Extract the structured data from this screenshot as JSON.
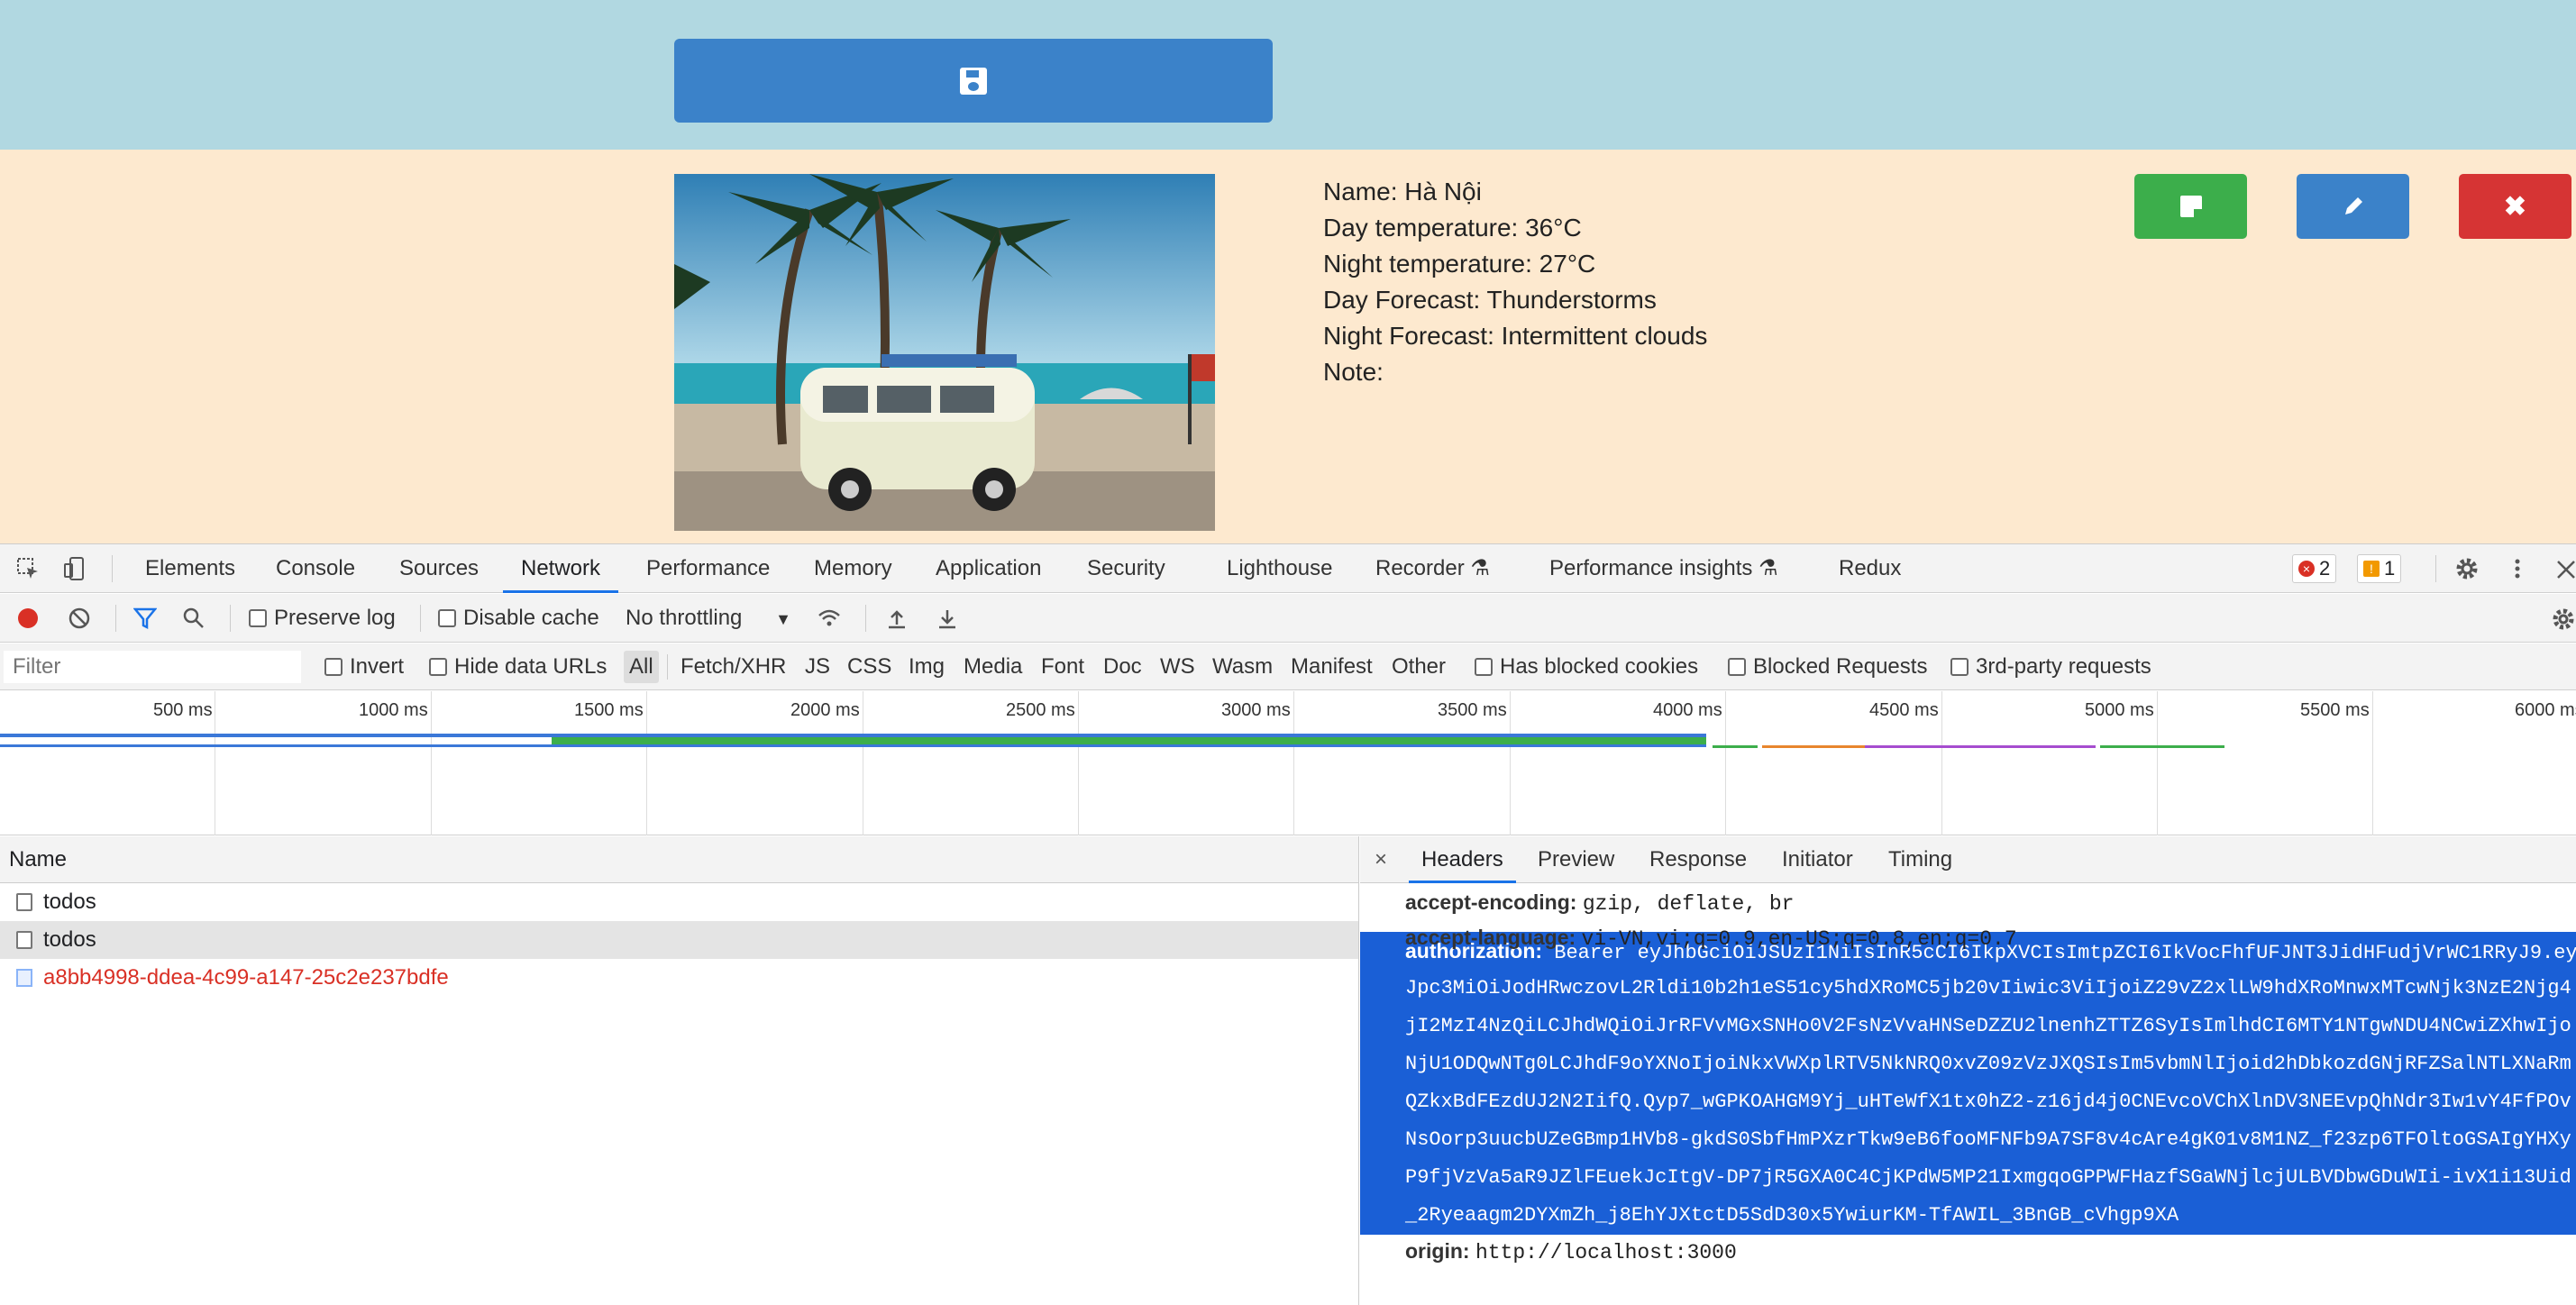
{
  "app": {
    "details": {
      "name": "Name: Hà Nội",
      "day_temp": "Day temperature: 36°C",
      "night_temp": "Night temperature: 27°C",
      "day_forecast": "Day Forecast: Thunderstorms",
      "night_forecast": "Night Forecast: Intermittent clouds",
      "note": "Note:"
    },
    "delete_label": "✖"
  },
  "devtools": {
    "tabs": [
      "Elements",
      "Console",
      "Sources",
      "Network",
      "Performance",
      "Memory",
      "Application",
      "Security",
      "Lighthouse",
      "Recorder",
      "Performance insights",
      "Redux"
    ],
    "active_tab": "Network",
    "errors": "2",
    "warnings": "1",
    "toolbar": {
      "preserve_log": "Preserve log",
      "disable_cache": "Disable cache",
      "throttling": "No throttling"
    },
    "filter": {
      "placeholder": "Filter",
      "invert": "Invert",
      "hide_data_urls": "Hide data URLs",
      "types": [
        "All",
        "Fetch/XHR",
        "JS",
        "CSS",
        "Img",
        "Media",
        "Font",
        "Doc",
        "WS",
        "Wasm",
        "Manifest",
        "Other"
      ],
      "has_blocked_cookies": "Has blocked cookies",
      "blocked_requests": "Blocked Requests",
      "third_party": "3rd-party requests"
    },
    "timeline_ticks": [
      "500 ms",
      "1000 ms",
      "1500 ms",
      "2000 ms",
      "2500 ms",
      "3000 ms",
      "3500 ms",
      "4000 ms",
      "4500 ms",
      "5000 ms",
      "5500 ms",
      "6000 ms"
    ],
    "requests": {
      "header": "Name",
      "rows": [
        "todos",
        "todos",
        "a8bb4998-ddea-4c99-a147-25c2e237bdfe"
      ]
    },
    "details": {
      "close": "×",
      "tabs": [
        "Headers",
        "Preview",
        "Response",
        "Initiator",
        "Timing"
      ],
      "accept_encoding_key": "accept-encoding:",
      "accept_encoding_val": "gzip, deflate, br",
      "accept_language_key": "accept-language:",
      "accept_language_val": "vi-VN,vi;q=0.9,en-US;q=0.8,en;q=0.7",
      "authorization_key": "authorization:",
      "authorization_lines": [
        "Bearer eyJhbGciOiJSUzI1NiIsInR5cCI6IkpXVCIsImtpZCI6IkVocFhfUFJNT3JidHFudjVrWC1RRyJ9.ey",
        "Jpc3MiOiJodHRwczovL2Rldi10b2h1eS51cy5hdXRoMC5jb20vIiwic3ViIjoiZ29vZ2xlLW9hdXRoMnwxMTcwNjk3NzE2Njg4",
        "jI2MzI4NzQiLCJhdWQiOiJrRFVvMGxSNHo0V2FsNzVvaHNSeDZZU2lnenhZTTZ6SyIsImlhdCI6MTY1NTgwNDU4NCwiZXhwIjo",
        "NjU1ODQwNTg0LCJhdF9oYXNoIjoiNkxVWXplRTV5NkNRQ0xvZ09zVzJXQSIsIm5vbmNlIjoid2hDbkozdGNjRFZSalNTLXNaRm",
        "QZkxBdFEzdUJ2N2IifQ.Qyp7_wGPKOAHGM9Yj_uHTeWfX1tx0hZ2-z16jd4j0CNEvcoVChXlnDV3NEEvpQhNdr3Iw1vY4FfPOv",
        "NsOorp3uucbUZeGBmp1HVb8-gkdS0SbfHmPXzrTkw9eB6fooMFNFb9A7SF8v4cAre4gK01v8M1NZ_f23zp6TFOltoGSAIgYHXy",
        "P9fjVzVa5aR9JZlFEuekJcItgV-DP7jR5GXA0C4CjKPdW5MP21IxmgqoGPPWFHazfSGaWNjlcjULBVDbwGDuWIi-ivX1i13Uid",
        "_2Ryeaagm2DYXmZh_j8EhYJXtctD5SdD30x5YwiurKM-TfAWIL_3BnGB_cVhgp9XA"
      ],
      "origin_key": "origin:",
      "origin_val": "http://localhost:3000"
    }
  },
  "colors": {
    "header_bg": "#b1d8e1",
    "card_bg": "#fde9cf",
    "primary": "#3b82c9",
    "success": "#3cae4b",
    "danger": "#d63434",
    "devtools_accent": "#1a73e8",
    "selection": "#1a5fd6"
  }
}
